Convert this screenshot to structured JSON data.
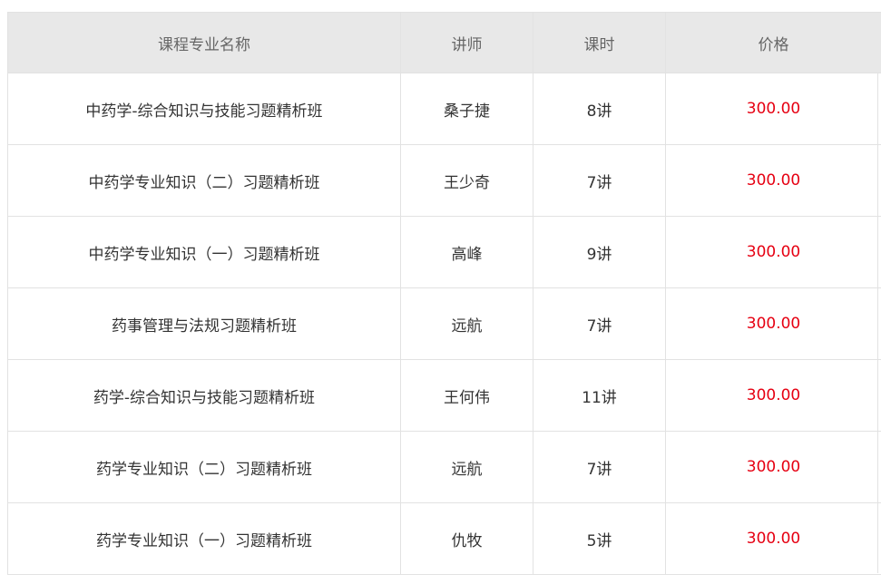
{
  "headers": {
    "name": "课程专业名称",
    "teacher": "讲师",
    "hours": "课时",
    "price": "价格"
  },
  "rows": [
    {
      "name": "中药学-综合知识与技能习题精析班",
      "teacher": "桑子捷",
      "hours": "8讲",
      "price": "300.00"
    },
    {
      "name": "中药学专业知识（二）习题精析班",
      "teacher": "王少奇",
      "hours": "7讲",
      "price": "300.00"
    },
    {
      "name": "中药学专业知识（一）习题精析班",
      "teacher": "高峰",
      "hours": "9讲",
      "price": "300.00"
    },
    {
      "name": "药事管理与法规习题精析班",
      "teacher": "远航",
      "hours": "7讲",
      "price": "300.00"
    },
    {
      "name": "药学-综合知识与技能习题精析班",
      "teacher": "王何伟",
      "hours": "11讲",
      "price": "300.00"
    },
    {
      "name": "药学专业知识（二）习题精析班",
      "teacher": "远航",
      "hours": "7讲",
      "price": "300.00"
    },
    {
      "name": "药学专业知识（一）习题精析班",
      "teacher": "仇牧",
      "hours": "5讲",
      "price": "300.00"
    }
  ],
  "colors": {
    "header_bg": "#e8e8e8",
    "border": "#e2e2e2",
    "price": "#e60012"
  }
}
